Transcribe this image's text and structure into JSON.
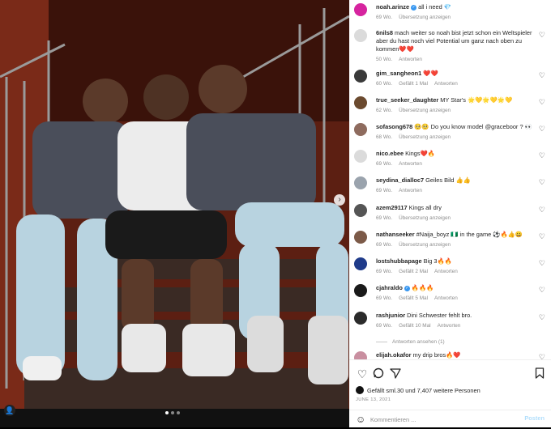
{
  "post": {
    "date": "JUNE 13, 2021",
    "likes_text": "Gefällt sml.30 und 7,407 weitere Personen",
    "add_comment_placeholder": "Kommentieren ...",
    "post_label": "Posten",
    "view_replies": "Antworten ansehen (1)"
  },
  "comments": [
    {
      "user": "noah.arinze",
      "verified": true,
      "text": "all i need 💎",
      "meta": [
        "69 Wo.",
        "Übersetzung anzeigen"
      ],
      "avatar_color": "#d6249f",
      "heart": false
    },
    {
      "user": "6nils8",
      "verified": false,
      "text": "mach weiter so noah bist jetzt schon ein Weltspieler aber du hast noch viel Potential um ganz nach oben zu kommen❤️❤️",
      "meta": [
        "50 Wo.",
        "Antworten"
      ],
      "avatar_color": "#dbdbdb",
      "heart": true
    },
    {
      "user": "gim_sangheon1",
      "verified": false,
      "text": "❤️❤️",
      "meta": [
        "60 Wo.",
        "Gefällt 1 Mal",
        "Antworten"
      ],
      "avatar_color": "#3a3a3a",
      "heart": true
    },
    {
      "user": "true_seeker_daughter",
      "verified": false,
      "text": "MY Star's 🌟💛🌟💛🌟💛",
      "meta": [
        "62 Wo.",
        "Übersetzung anzeigen"
      ],
      "avatar_color": "#6b4a2f",
      "heart": true
    },
    {
      "user": "sofasong678",
      "verified": false,
      "text": "🥺🥺 Do you know model @graceboor ? 👀",
      "meta": [
        "68 Wo.",
        "Übersetzung anzeigen"
      ],
      "avatar_color": "#8e6b5e",
      "heart": true
    },
    {
      "user": "nico.ebee",
      "verified": false,
      "text": "Kings❤️🔥",
      "meta": [
        "69 Wo.",
        "Antworten"
      ],
      "avatar_color": "#dbdbdb",
      "heart": true
    },
    {
      "user": "seydina_dialloc7",
      "verified": false,
      "text": "Geiles Bild 👍👍",
      "meta": [
        "69 Wo.",
        "Antworten"
      ],
      "avatar_color": "#9aa3ad",
      "heart": true
    },
    {
      "user": "azem29117",
      "verified": false,
      "text": "Kings all dry",
      "meta": [
        "69 Wo.",
        "Übersetzung anzeigen"
      ],
      "avatar_color": "#555555",
      "heart": true
    },
    {
      "user": "nathanseeker",
      "verified": false,
      "text": "#Naija_boyz 🇳🇬 in the game ⚽️🔥👍😀",
      "meta": [
        "69 Wo.",
        "Übersetzung anzeigen"
      ],
      "avatar_color": "#7c5a48",
      "heart": true
    },
    {
      "user": "lostshubbapage",
      "verified": false,
      "text": "Big 3🔥🔥",
      "meta": [
        "69 Wo.",
        "Gefällt 2 Mal",
        "Antworten"
      ],
      "avatar_color": "#1f3b8a",
      "heart": true
    },
    {
      "user": "cjahraldo",
      "verified": true,
      "text": "🔥🔥🔥",
      "meta": [
        "69 Wo.",
        "Gefällt 5 Mal",
        "Antworten"
      ],
      "avatar_color": "#1a1a1a",
      "heart": true
    },
    {
      "user": "rashjunior",
      "verified": false,
      "text": "Dini Schwester fehlt bro.",
      "meta": [
        "69 Wo.",
        "Gefällt 10 Mal",
        "Antworten"
      ],
      "avatar_color": "#2b2b2b",
      "heart": true
    },
    {
      "user": "elijah.okafor",
      "verified": false,
      "text": "my drip bros🔥❤️",
      "meta": [],
      "avatar_color": "#c98fa0",
      "heart": true
    }
  ],
  "icons": {
    "heart": "heart-icon",
    "comment": "comment-icon",
    "share": "share-icon",
    "save": "bookmark-icon",
    "emoji": "emoji-icon"
  }
}
